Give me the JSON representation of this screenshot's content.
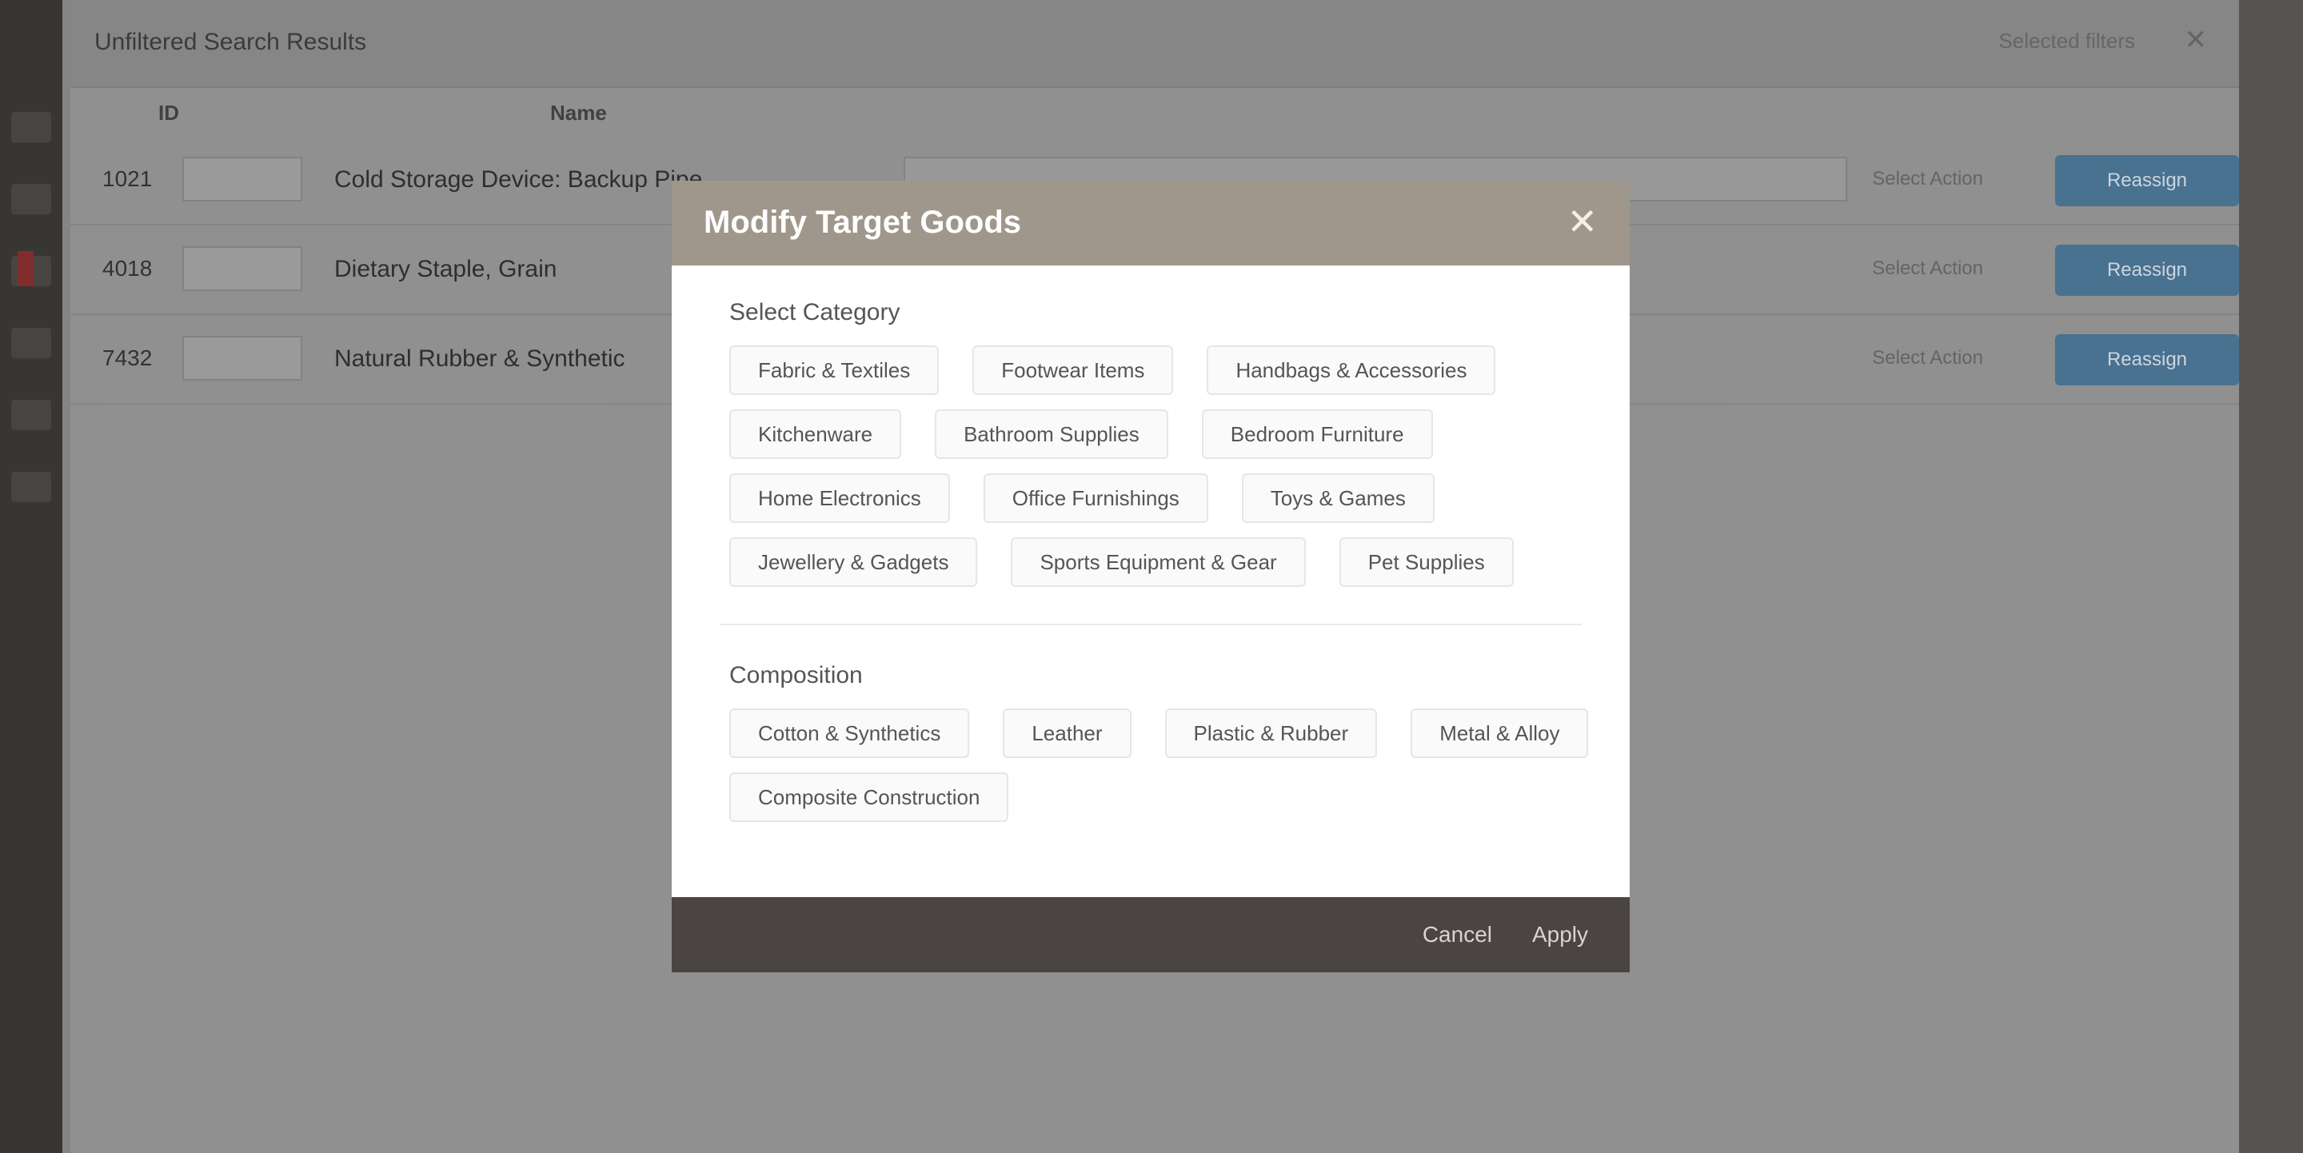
{
  "app": {
    "title": "Unfiltered Search Results"
  },
  "topbar": {
    "right_text": "Selected filters",
    "close_glyph": "✕"
  },
  "columns": {
    "col1": "ID",
    "col2": "Name"
  },
  "rows": [
    {
      "id": "1021",
      "name": "Cold Storage Device: Backup Pipe",
      "meta": "Select Action",
      "button": "Reassign"
    },
    {
      "id": "4018",
      "name": "Dietary Staple, Grain",
      "meta": "Select Action",
      "button": "Reassign"
    },
    {
      "id": "7432",
      "name": "Natural Rubber & Synthetic",
      "meta": "Select Action",
      "button": "Reassign"
    }
  ],
  "modal": {
    "title": "Modify Target Goods",
    "close_glyph": "✕",
    "section1": {
      "label": "Select Category",
      "chips": [
        [
          "Fabric & Textiles",
          "Footwear Items",
          "Handbags & Accessories"
        ],
        [
          "Kitchenware",
          "Bathroom Supplies",
          "Bedroom Furniture"
        ],
        [
          "Home Electronics",
          "Office Furnishings",
          "Toys & Games"
        ],
        [
          "Jewellery & Gadgets",
          "Sports Equipment & Gear",
          "Pet Supplies"
        ]
      ]
    },
    "section2": {
      "label": "Composition",
      "chips": [
        [
          "Cotton & Synthetics",
          "Leather",
          "Plastic & Rubber",
          "Metal & Alloy"
        ],
        [
          "Composite Construction"
        ]
      ]
    },
    "footer": {
      "cancel": "Cancel",
      "apply": "Apply"
    }
  }
}
